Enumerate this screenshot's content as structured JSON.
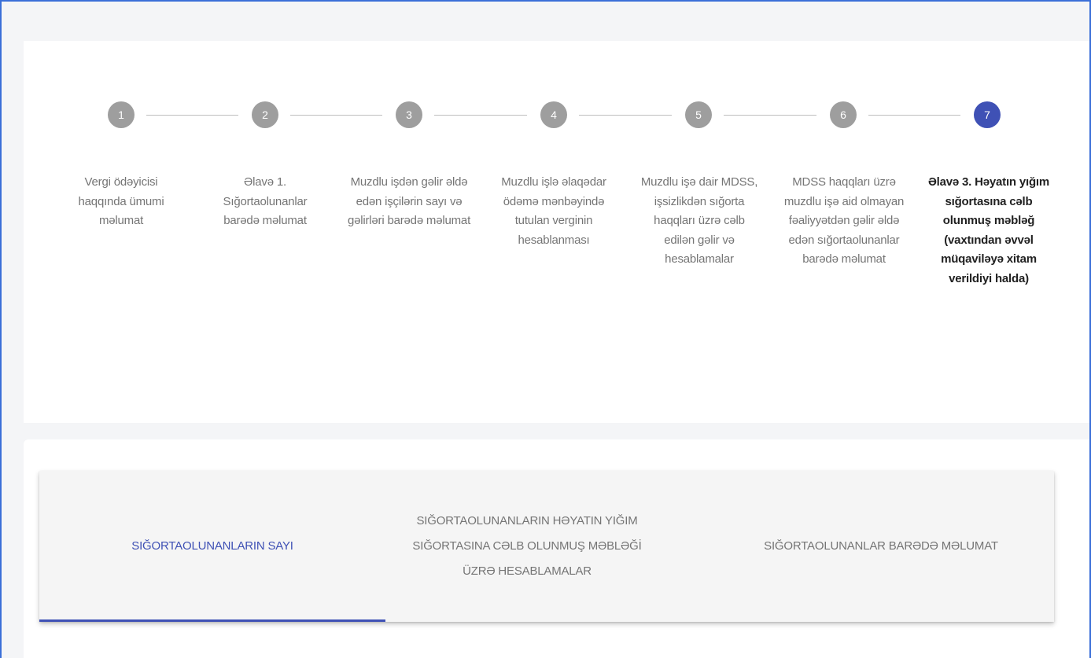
{
  "stepper": {
    "active_step": 7,
    "steps": [
      {
        "number": "1",
        "label": "Vergi ödəyicisi haqqında ümumi məlumat"
      },
      {
        "number": "2",
        "label": "Əlavə 1. Sığortaolunanlar barədə məlumat"
      },
      {
        "number": "3",
        "label": "Muzdlu işdən gəlir əldə edən işçilərin sayı və gəlirləri barədə məlumat"
      },
      {
        "number": "4",
        "label": "Muzdlu işlə əlaqədar ödəmə mənbəyində tutulan verginin hesablanması"
      },
      {
        "number": "5",
        "label": "Muzdlu işə dair MDSS, işsizlikdən sığorta haqqları üzrə cəlb edilən gəlir və hesablamalar"
      },
      {
        "number": "6",
        "label": "MDSS haqqları üzrə muzdlu işə aid olmayan fəaliyyətdən gəlir əldə edən sığortaolunanlar barədə məlumat"
      },
      {
        "number": "7",
        "label": "Əlavə 3. Həyatın yığım sığortasına cəlb olunmuş məbləğ (vaxtından əvvəl müqaviləyə xitam verildiyi halda)"
      }
    ]
  },
  "tabs": {
    "items": [
      {
        "label": "SIĞORTAOLUNANLARIN SAYI"
      },
      {
        "label": "SIĞORTAOLUNANLARIN HƏYATIN YIĞIM SIĞORTASINA CƏLB OLUNMUŞ MƏBLƏĞİ ÜZRƏ HESABLAMALAR"
      },
      {
        "label": "SIĞORTAOLUNANLAR BARƏDƏ MƏLUMAT"
      }
    ],
    "active_index": 0
  },
  "colors": {
    "accent": "#3f51b5",
    "inactive_step": "#9e9e9e",
    "frame_border": "#3a6fd8"
  }
}
